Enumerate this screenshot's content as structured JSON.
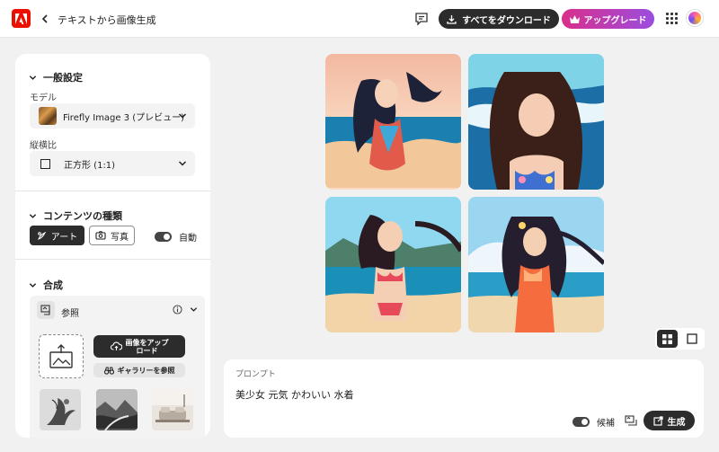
{
  "header": {
    "title": "テキストから画像生成",
    "download_label": "すべてをダウンロード",
    "upgrade_label": "アップグレード"
  },
  "general": {
    "heading": "一般設定",
    "model_label": "モデル",
    "model_value": "Firefly Image 3 (プレビュー)",
    "aspect_label": "縦横比",
    "aspect_value": "正方形 (1:1)"
  },
  "content_type": {
    "heading": "コンテンツの種類",
    "art_label": "アート",
    "photo_label": "写真",
    "auto_label": "自動"
  },
  "composition": {
    "heading": "合成",
    "reference_label": "参照",
    "upload_label_1": "画像をアップ",
    "upload_label_2": "ロード",
    "gallery_label": "ギャラリーを参照"
  },
  "prompt": {
    "label": "プロンプト",
    "text": "美少女 元気 かわいい 水着",
    "candidates_label": "候補",
    "generate_label": "生成"
  },
  "colors": {
    "accent_dark": "#2c2c2c",
    "adobe_red": "#eb1000",
    "upgrade_start": "#d92f8a",
    "upgrade_end": "#9b4de0"
  },
  "icons": [
    "adobe-logo-icon",
    "back-chevron-icon",
    "feedback-icon",
    "download-icon",
    "crown-icon",
    "apps-grid-icon",
    "chevron-down-icon",
    "square-icon",
    "art-brush-icon",
    "camera-icon",
    "reference-icon",
    "info-icon",
    "upload-image-icon",
    "cloud-upload-icon",
    "binoculars-icon",
    "grid-view-icon",
    "single-view-icon",
    "compare-icon",
    "generate-icon"
  ]
}
